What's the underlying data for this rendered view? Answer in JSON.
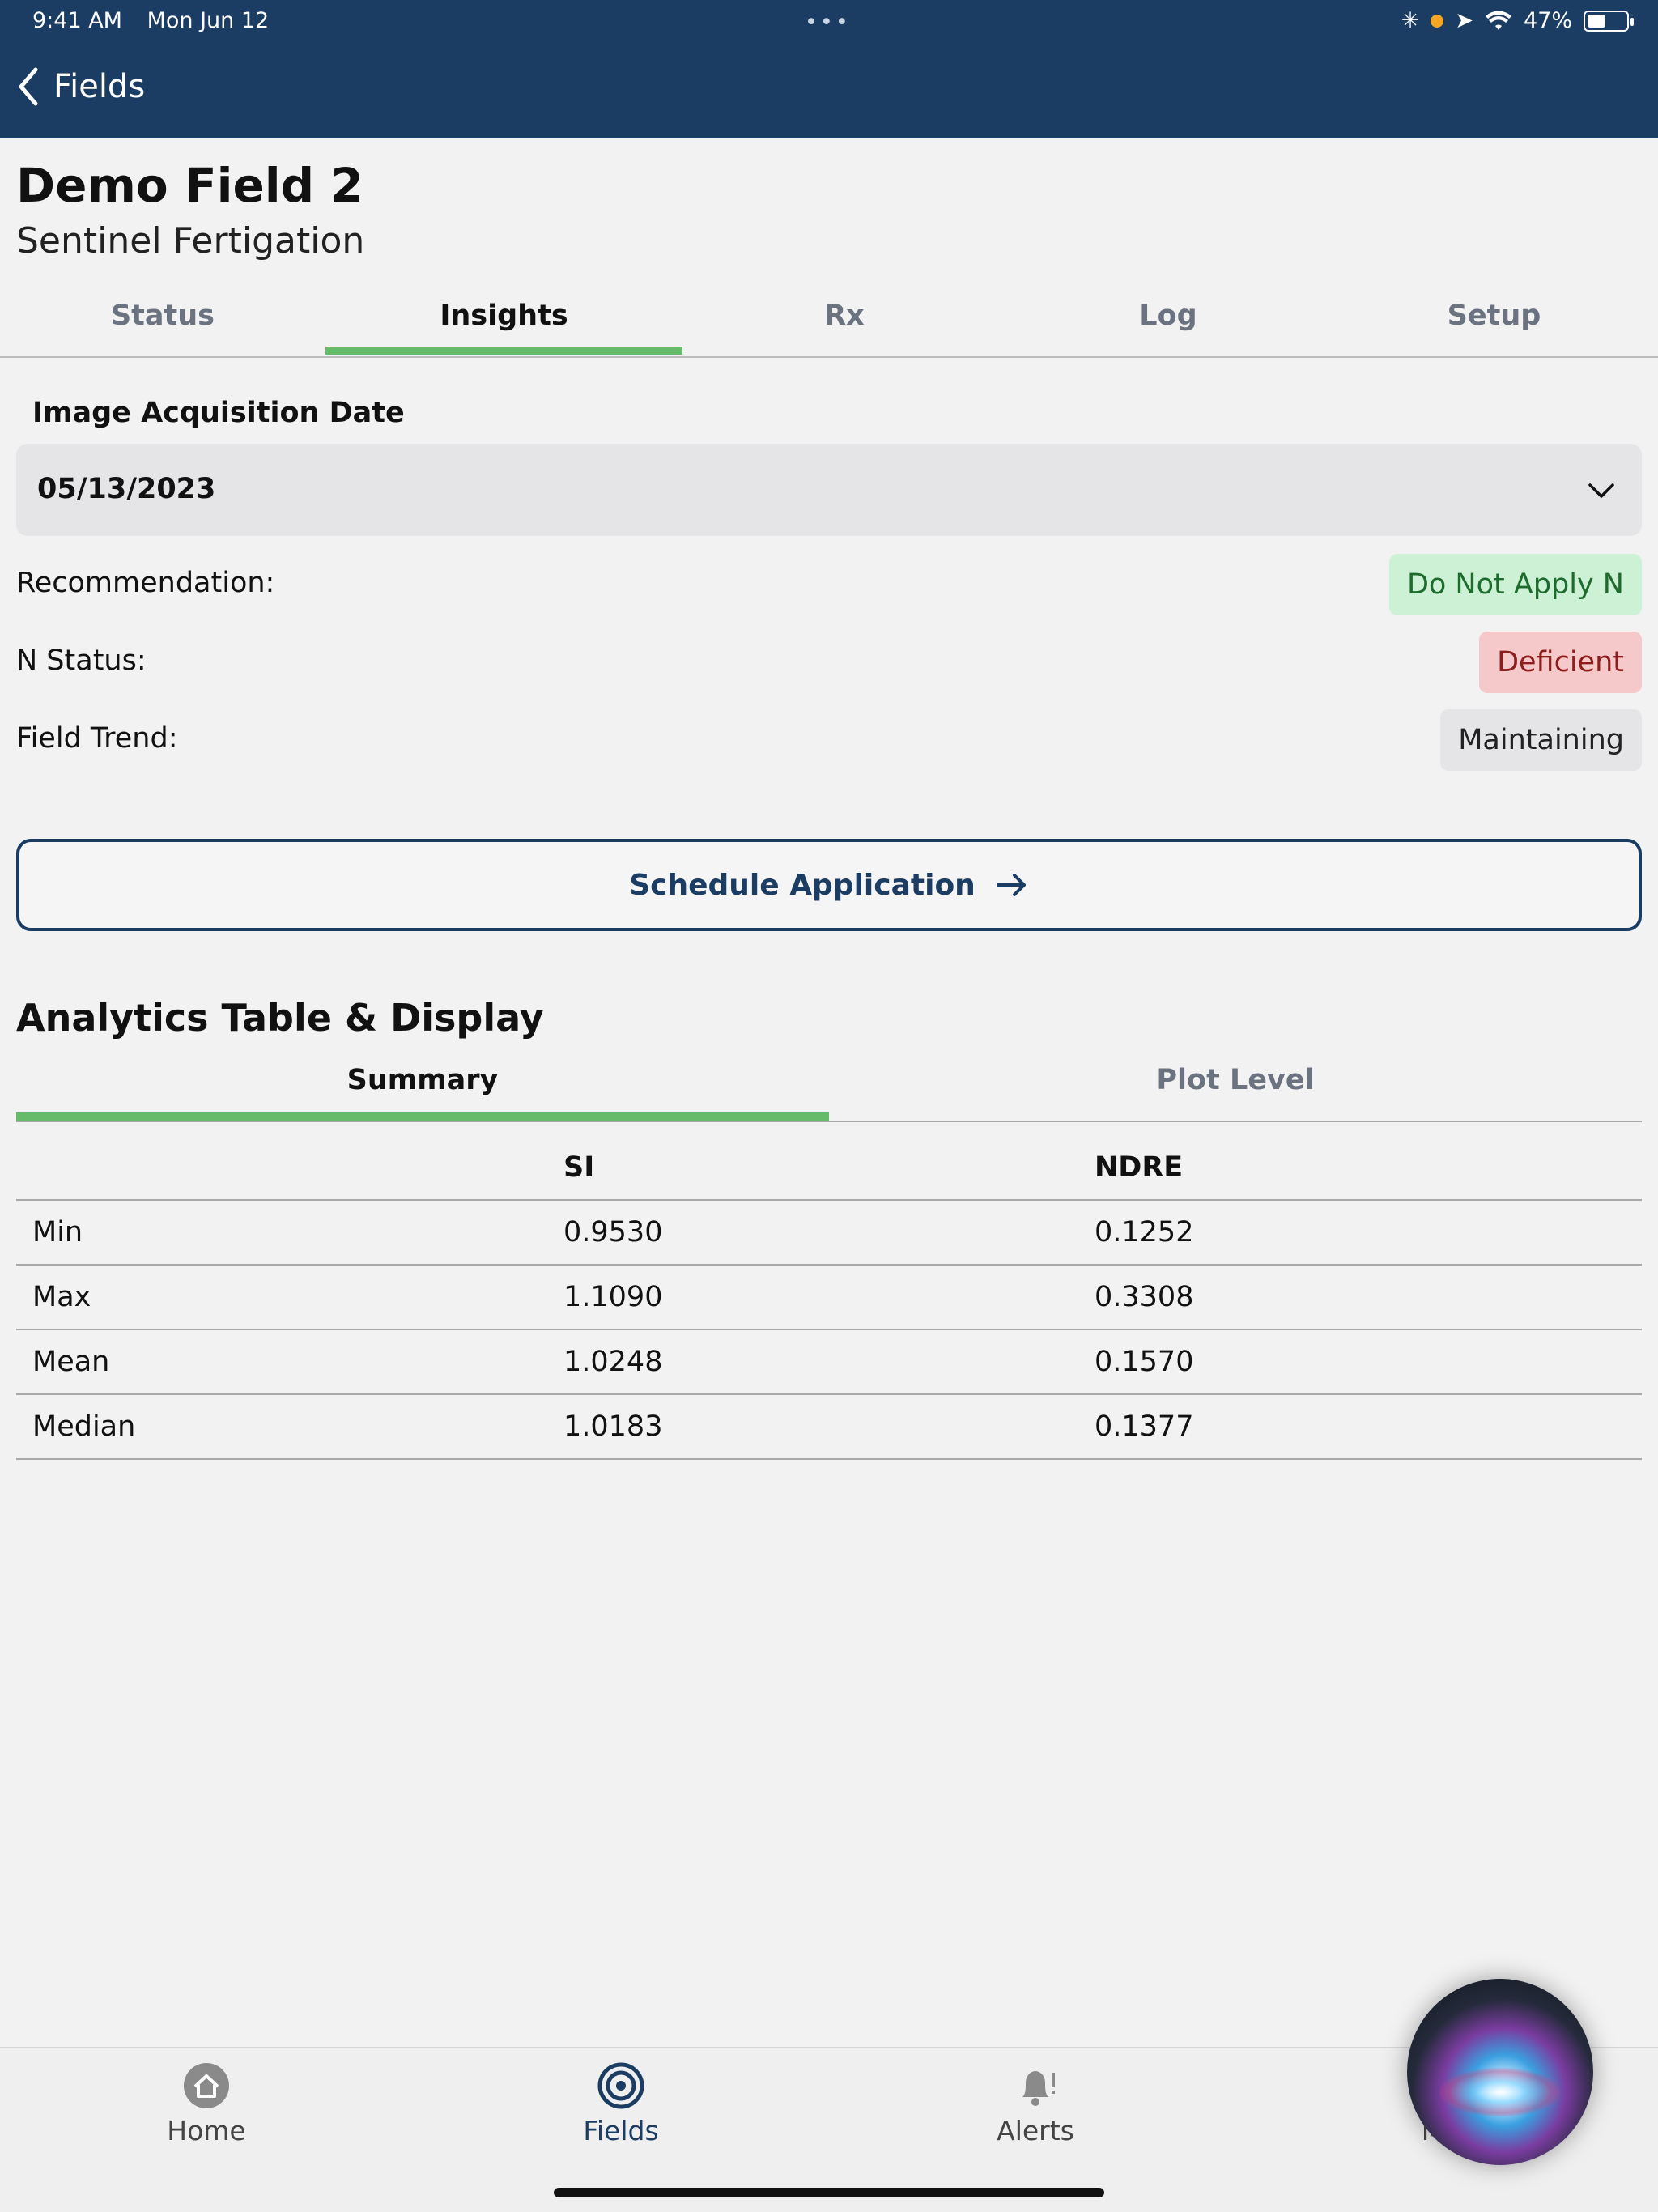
{
  "status_bar": {
    "time": "9:41 AM",
    "date": "Mon Jun 12",
    "dots": "•••",
    "battery": "47%",
    "battery_fraction": 0.47
  },
  "nav": {
    "back_label": "Fields"
  },
  "header": {
    "title": "Demo Field 2",
    "subtitle": "Sentinel Fertigation"
  },
  "tabs": [
    {
      "label": "Status"
    },
    {
      "label": "Insights",
      "active": true
    },
    {
      "label": "Rx"
    },
    {
      "label": "Log"
    },
    {
      "label": "Setup"
    }
  ],
  "acquisition": {
    "label": "Image Acquisition Date",
    "value": "05/13/2023"
  },
  "info": {
    "recommendation": {
      "label": "Recommendation:",
      "value": "Do Not Apply N"
    },
    "n_status": {
      "label": "N Status:",
      "value": "Deficient"
    },
    "field_trend": {
      "label": "Field Trend:",
      "value": "Maintaining"
    }
  },
  "schedule_button": {
    "label": "Schedule Application"
  },
  "analytics": {
    "title": "Analytics Table & Display",
    "subtabs": [
      {
        "label": "Summary",
        "active": true
      },
      {
        "label": "Plot Level"
      }
    ],
    "table": {
      "headers": [
        "",
        "SI",
        "NDRE"
      ],
      "rows": [
        [
          "Min",
          "0.9530",
          "0.1252"
        ],
        [
          "Max",
          "1.1090",
          "0.3308"
        ],
        [
          "Mean",
          "1.0248",
          "0.1570"
        ],
        [
          "Median",
          "1.0183",
          "0.1377"
        ]
      ]
    }
  },
  "bottom_tabs": [
    {
      "label": "Home",
      "icon": "home-icon"
    },
    {
      "label": "Fields",
      "icon": "target-icon",
      "active": true
    },
    {
      "label": "Alerts",
      "icon": "bell-icon"
    },
    {
      "label": "M",
      "icon": "more-icon"
    }
  ],
  "colors": {
    "header_bg": "#1b3c63",
    "accent_green": "#66bb6a",
    "pill_green": "#ccf1d4",
    "pill_red": "#f5c9c9"
  }
}
